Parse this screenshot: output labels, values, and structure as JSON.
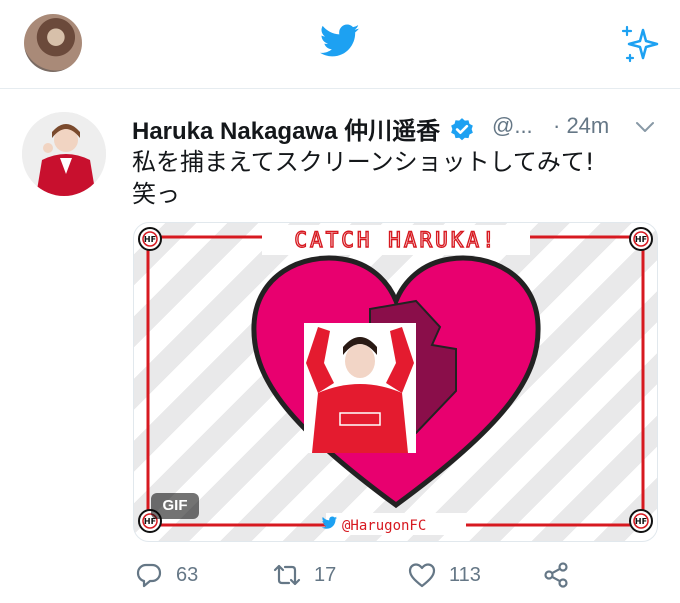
{
  "header_bar": {
    "profile_avatar_icon": "profile-avatar",
    "logo_icon": "twitter-bird-icon",
    "sparkle_icon": "sparkle-icon",
    "accent_color": "#1da1f2"
  },
  "tweet": {
    "author_name": "Haruka Nakagawa 仲川遥香",
    "handle": "@...",
    "timestamp": "· 24m",
    "text_line1": "私を捕まえてスクリーンショットしてみて!",
    "text_line2": "笑っ",
    "verified_icon": "verified-badge-icon",
    "more_icon": "chevron-down-icon"
  },
  "media": {
    "title": "CATCH HARUKA!",
    "corner_logo": "HF",
    "footer_handle": "@HarugonFC",
    "badge": "GIF",
    "heart_color": "#e8006f",
    "frame_color": "#d71920"
  },
  "actions": {
    "reply_count": "63",
    "retweet_count": "17",
    "like_count": "113",
    "icons": [
      "reply-icon",
      "retweet-icon",
      "like-icon",
      "share-icon"
    ]
  }
}
